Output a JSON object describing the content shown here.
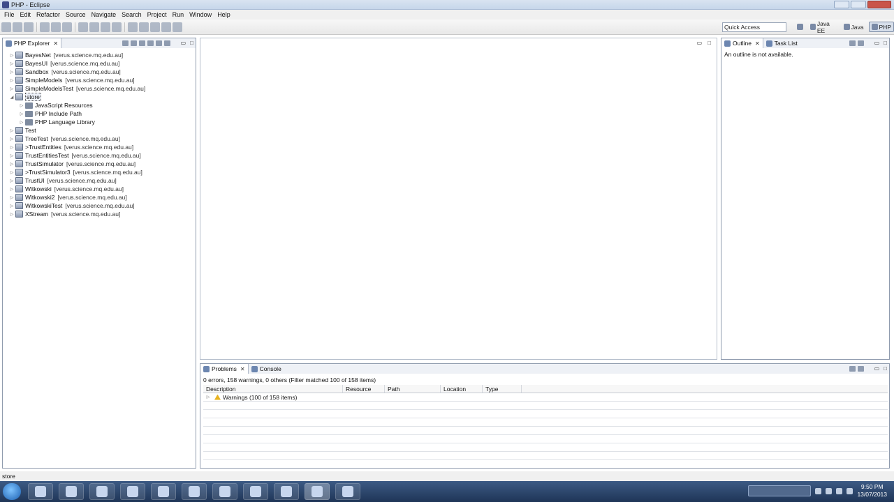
{
  "window": {
    "title": "PHP - Eclipse"
  },
  "menu": [
    "File",
    "Edit",
    "Refactor",
    "Source",
    "Navigate",
    "Search",
    "Project",
    "Run",
    "Window",
    "Help"
  ],
  "toolbar": {
    "quick_access_placeholder": "Quick Access",
    "perspectives": [
      "Java EE",
      "Java",
      "PHP"
    ],
    "active_perspective": "PHP"
  },
  "explorer": {
    "tab_label": "PHP Explorer",
    "tree": [
      {
        "label": "BayesNet",
        "repo": "[verus.science.mq.edu.au]",
        "level": 0,
        "expanded": false
      },
      {
        "label": "BayesUI",
        "repo": "[verus.science.mq.edu.au]",
        "level": 0,
        "expanded": false
      },
      {
        "label": "Sandbox",
        "repo": "[verus.science.mq.edu.au]",
        "level": 0,
        "expanded": false
      },
      {
        "label": "SimpleModels",
        "repo": "[verus.science.mq.edu.au]",
        "level": 0,
        "expanded": false
      },
      {
        "label": "SimpleModelsTest",
        "repo": "[verus.science.mq.edu.au]",
        "level": 0,
        "expanded": false
      },
      {
        "label": "store",
        "repo": "",
        "level": 0,
        "expanded": true,
        "selected": true
      },
      {
        "label": "JavaScript Resources",
        "repo": "",
        "level": 1,
        "expanded": false
      },
      {
        "label": "PHP Include Path",
        "repo": "",
        "level": 1,
        "expanded": false
      },
      {
        "label": "PHP Language Library",
        "repo": "",
        "level": 1,
        "expanded": false
      },
      {
        "label": "Test",
        "repo": "",
        "level": 0,
        "expanded": false
      },
      {
        "label": "TreeTest",
        "repo": "[verus.science.mq.edu.au]",
        "level": 0,
        "expanded": false
      },
      {
        "label": ">TrustEntities",
        "repo": "[verus.science.mq.edu.au]",
        "level": 0,
        "expanded": false
      },
      {
        "label": "TrustEntitiesTest",
        "repo": "[verus.science.mq.edu.au]",
        "level": 0,
        "expanded": false
      },
      {
        "label": "TrustSimulator",
        "repo": "[verus.science.mq.edu.au]",
        "level": 0,
        "expanded": false
      },
      {
        "label": ">TrustSimulator3",
        "repo": "[verus.science.mq.edu.au]",
        "level": 0,
        "expanded": false
      },
      {
        "label": "TrustUI",
        "repo": "[verus.science.mq.edu.au]",
        "level": 0,
        "expanded": false
      },
      {
        "label": "Witkowski",
        "repo": "[verus.science.mq.edu.au]",
        "level": 0,
        "expanded": false
      },
      {
        "label": "Witkowski2",
        "repo": "[verus.science.mq.edu.au]",
        "level": 0,
        "expanded": false
      },
      {
        "label": "WitkowskiTest",
        "repo": "[verus.science.mq.edu.au]",
        "level": 0,
        "expanded": false
      },
      {
        "label": "XStream",
        "repo": "[verus.science.mq.edu.au]",
        "level": 0,
        "expanded": false
      }
    ]
  },
  "outline": {
    "tabs": [
      "Outline",
      "Task List"
    ],
    "message": "An outline is not available."
  },
  "problems": {
    "tabs": [
      "Problems",
      "Console"
    ],
    "summary": "0 errors, 158 warnings, 0 others (Filter matched 100 of 158 items)",
    "columns": [
      "Description",
      "Resource",
      "Path",
      "Location",
      "Type"
    ],
    "rows": [
      {
        "description": "Warnings (100 of 158 items)"
      }
    ]
  },
  "status": {
    "text": "store"
  },
  "taskbar": {
    "time": "9:50 PM",
    "date": "13/07/2013"
  },
  "colors": {
    "panel_border": "#8f9bae",
    "taskbar": "#1f3557",
    "warning": "#e8b320"
  }
}
